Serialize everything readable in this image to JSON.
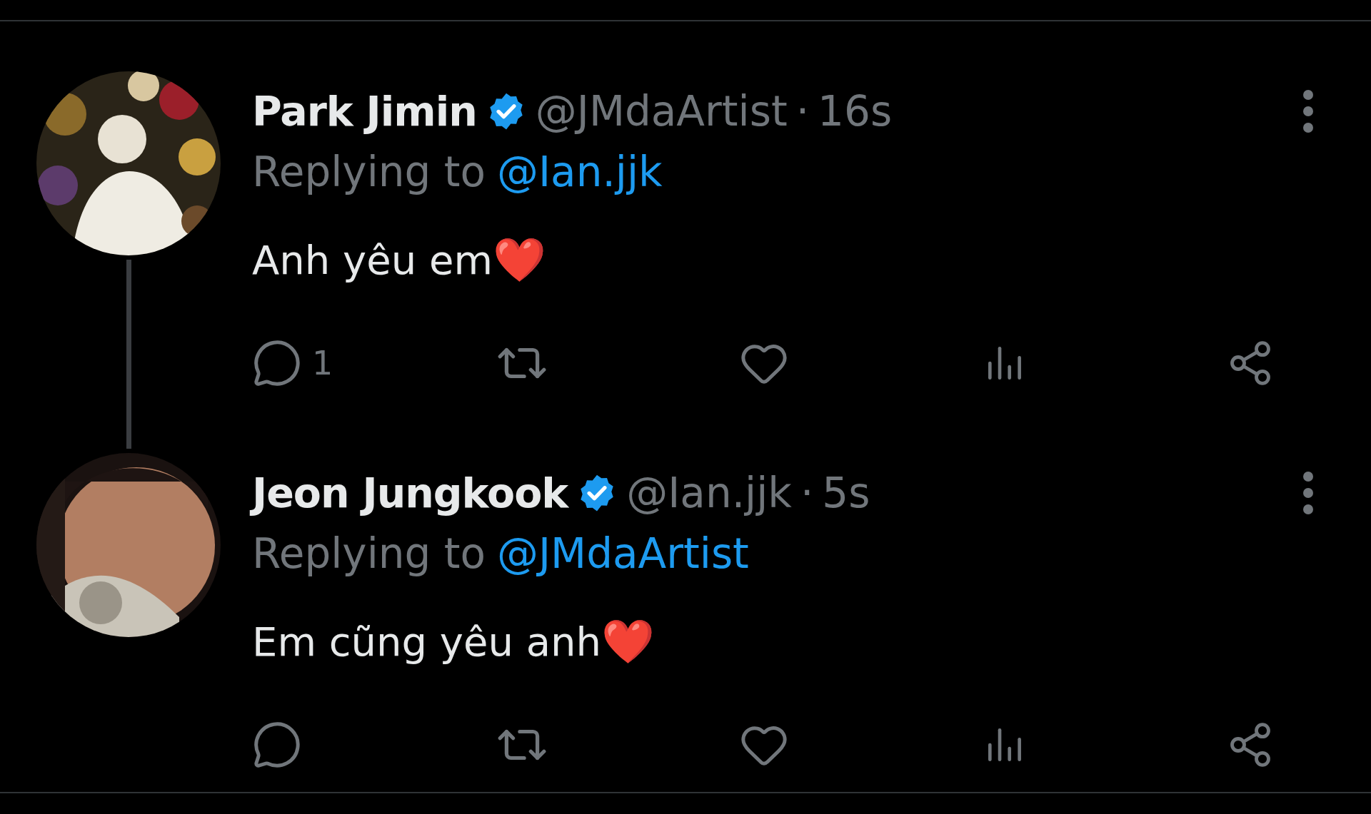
{
  "tweets": [
    {
      "name": "Park Jimin",
      "verified": true,
      "handle": "@JMdaArtist",
      "separator": "·",
      "time": "16s",
      "replying_prefix": "Replying to",
      "reply_handle": "@Ian.jjk",
      "text": "Anh yêu em",
      "emoji": "❤️",
      "thread_continues": true,
      "reply_count": "1"
    },
    {
      "name": "Jeon Jungkook",
      "verified": true,
      "handle": "@Ian.jjk",
      "separator": "·",
      "time": "5s",
      "replying_prefix": "Replying to",
      "reply_handle": "@JMdaArtist",
      "text": "Em cũng yêu anh",
      "emoji": "❤️",
      "thread_continues": false
    }
  ]
}
